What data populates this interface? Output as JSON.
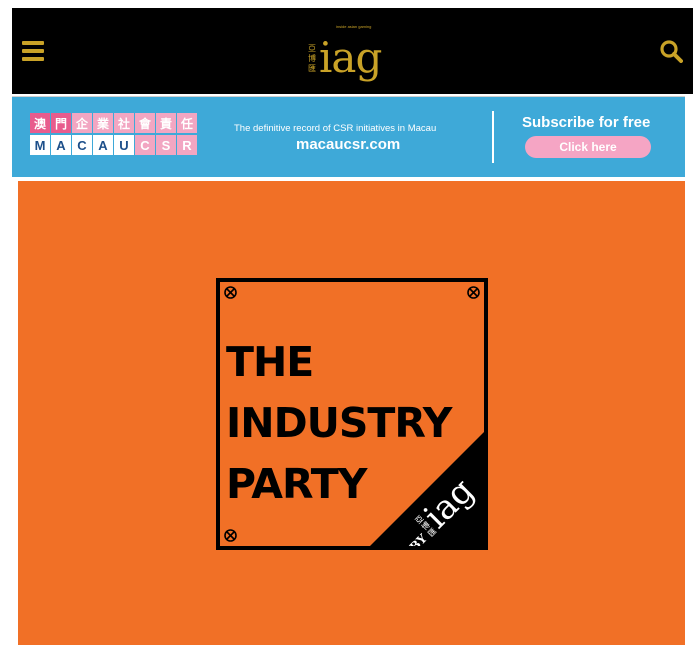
{
  "header": {
    "logo": {
      "chinese_chars": [
        "亞",
        "博",
        "匯"
      ],
      "wordmark": "iag",
      "tagline": "inside asian gaming"
    },
    "menu_icon": "hamburger-menu-icon",
    "search_icon": "search-icon",
    "colors": {
      "background": "#000000",
      "accent": "#c9a227"
    }
  },
  "banner": {
    "grid_top": [
      "澳",
      "門",
      "企",
      "業",
      "社",
      "會",
      "責",
      "任"
    ],
    "grid_bottom": [
      "M",
      "A",
      "C",
      "A",
      "U",
      "C",
      "S",
      "R"
    ],
    "tagline": "The definitive record of CSR initiatives in Macau",
    "url": "macaucsr.com",
    "subscribe": "Subscribe for free",
    "click_here": "Click here",
    "colors": {
      "background": "#3ea9d8",
      "pink": "#e85c8d",
      "light_pink": "#f5a5c4",
      "navy": "#1d4f8a"
    }
  },
  "hero": {
    "title_lines": [
      "THE",
      "INDUSTRY",
      "PARTY"
    ],
    "corner_by": "BY",
    "corner_chars": [
      "亞",
      "博",
      "匯"
    ],
    "corner_wordmark": "iag",
    "colors": {
      "background": "#f17026",
      "ink": "#000000"
    }
  }
}
